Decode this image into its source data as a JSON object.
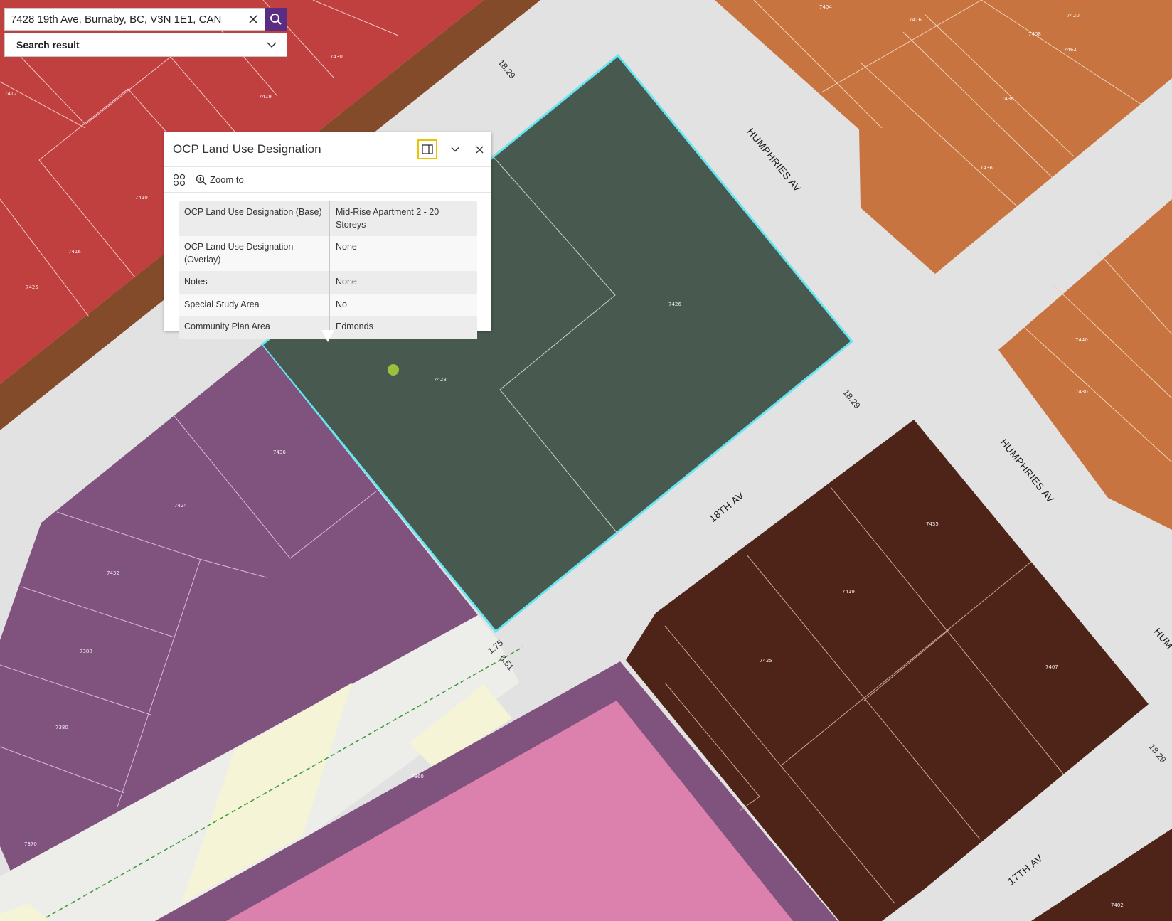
{
  "search": {
    "query": "7428 19th Ave, Burnaby, BC, V3N 1E1, CAN",
    "result_label": "Search result",
    "icons": {
      "clear": "close-icon",
      "submit": "search-icon",
      "expand": "chevron-down-icon"
    }
  },
  "popup": {
    "title": "OCP Land Use Designation",
    "zoom_label": "Zoom to",
    "icons": {
      "dock": "dock-panel-icon",
      "collapse": "chevron-down-icon",
      "close": "close-icon",
      "menu": "actions-grid-icon",
      "zoom": "zoom-in-icon"
    },
    "fields": [
      {
        "key": "OCP Land Use Designation (Base)",
        "value": "Mid-Rise Apartment 2 - 20 Storeys"
      },
      {
        "key": "OCP Land Use Designation (Overlay)",
        "value": "None"
      },
      {
        "key": "Notes",
        "value": "None"
      },
      {
        "key": "Special Study Area",
        "value": "No"
      },
      {
        "key": "Community Plan Area",
        "value": "Edmonds"
      }
    ]
  },
  "map": {
    "streets": [
      "HUMPHRIES AV",
      "HUMPHRIES AV",
      "18TH AV",
      "17TH AV",
      "HUM"
    ],
    "dimensions": [
      "18.29",
      "18.29",
      "18.29",
      "1.75",
      "6.51"
    ],
    "lot_numbers": [
      "7426",
      "7428",
      "7436",
      "7440",
      "7438",
      "7436",
      "7462",
      "7430",
      "7420",
      "7410",
      "7416",
      "7425",
      "7419",
      "7430",
      "7412",
      "7408",
      "7416",
      "7404",
      "7424",
      "7432",
      "7388",
      "7380",
      "7370",
      "7360",
      "7435",
      "7419",
      "7425",
      "7407",
      "7402"
    ],
    "colors": {
      "commercial": "#c04040",
      "residential_high": "#c87440",
      "selected_parcel": "#485a50",
      "selection_outline": "#66e6f0",
      "institutional": "#80527e",
      "mixed": "#4e2418",
      "public": "#dc80ae",
      "park": "#f5f4d6",
      "road": "#dedede"
    }
  }
}
